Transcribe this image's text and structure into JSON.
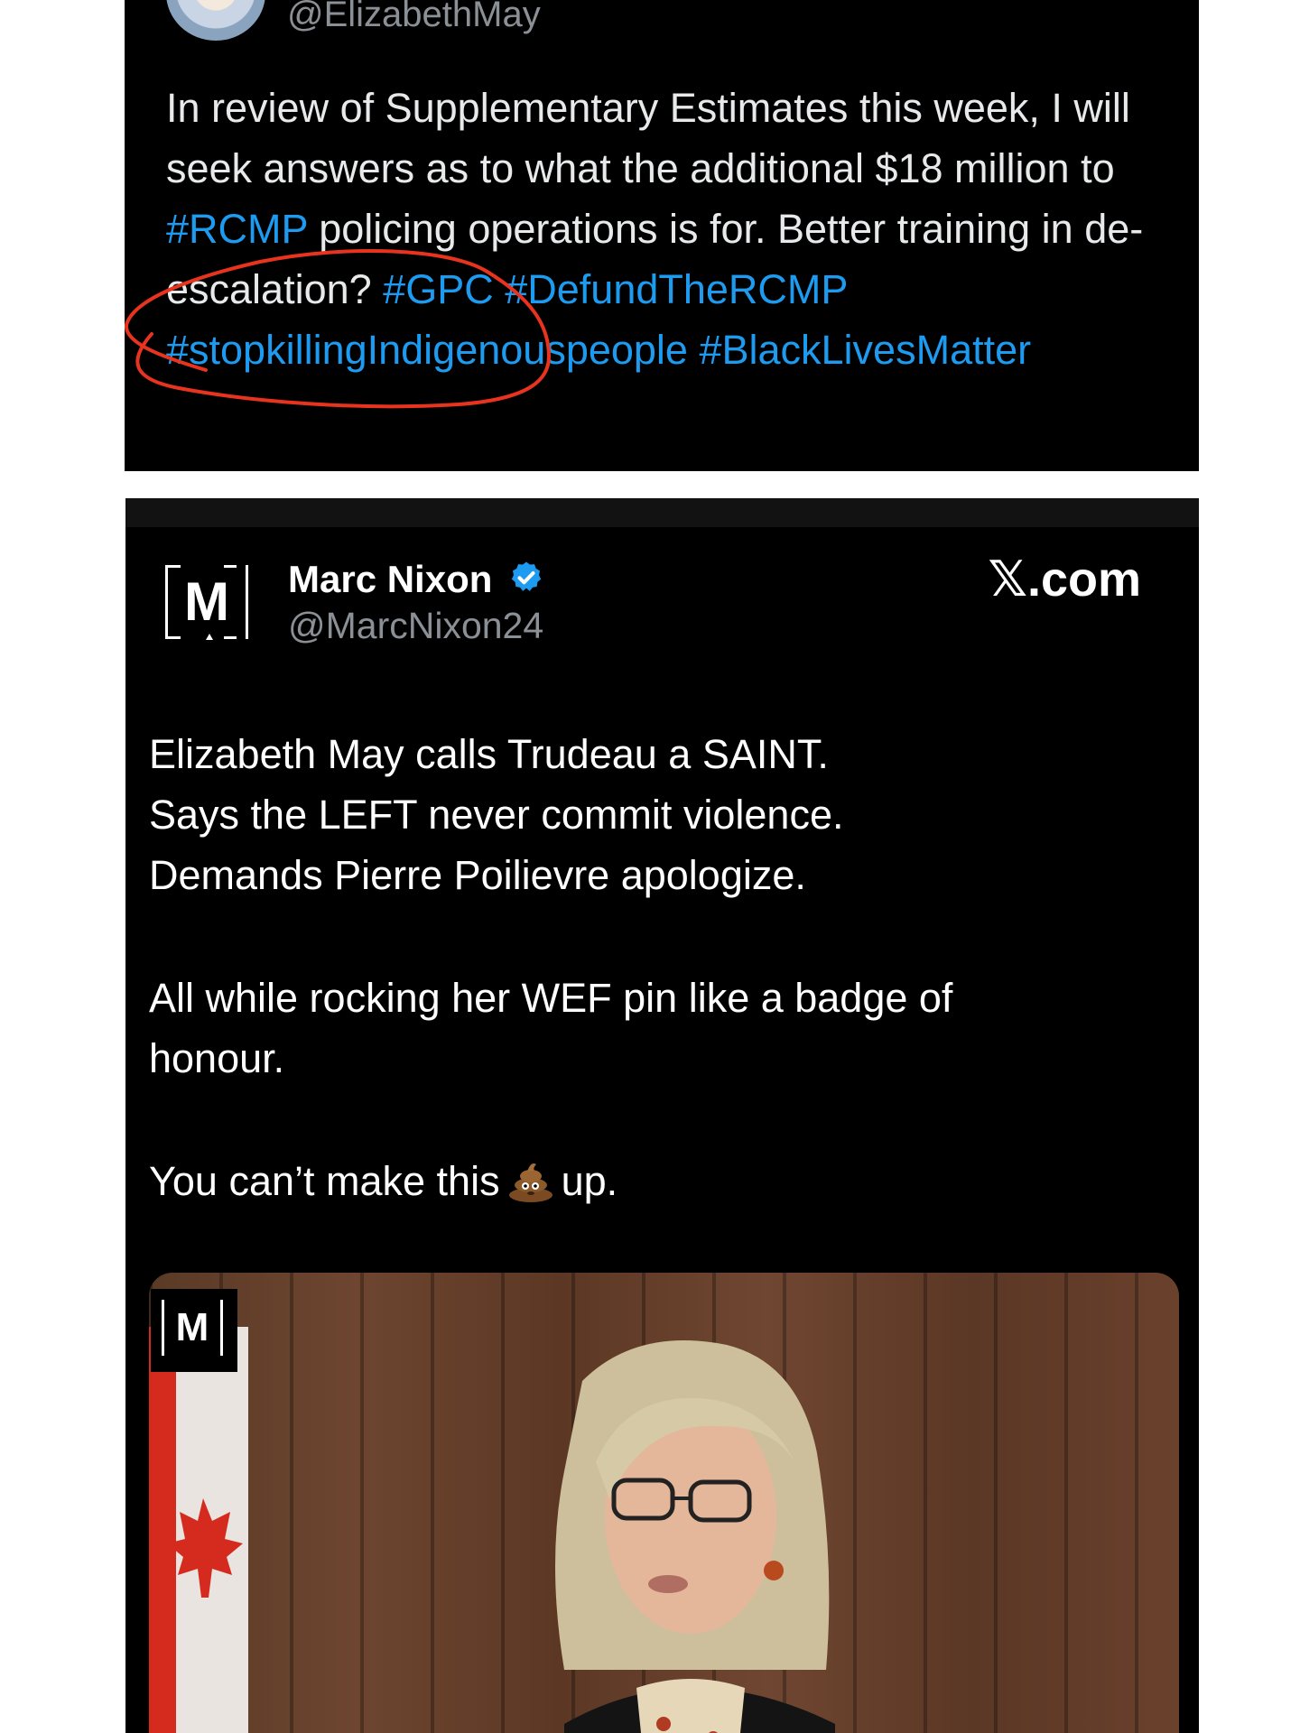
{
  "quoted_tweet": {
    "handle": "@ElizabethMay",
    "text_1": "In review of Supplementary Estimates this week, I will seek answers as to what the additional $18 million to ",
    "tag_rcmp": "#RCMP",
    "text_2": " policing operations is for. Better training in de-escalation? ",
    "tag_gpc": "#GPC",
    "tag_defund": "#DefundTheRCMP",
    "tag_stopkilling": "#stopkillingIndigenouspeople",
    "tag_blm": "#BlackLivesMatter",
    "hashtag_color": "#1d9bf0"
  },
  "post": {
    "author_name": "Marc Nixon",
    "author_handle": "@MarcNixon24",
    "logo_letter": "M",
    "brand": "𝕏.com",
    "verified_color": "#1d9bf0",
    "line_1": "Elizabeth May calls Trudeau a SAINT.",
    "line_2": "Says the LEFT never commit violence.",
    "line_3": "Demands Pierre Poilievre apologize.",
    "line_4": "All while rocking her WEF pin like a badge of",
    "line_5": "honour.",
    "line_6a": "You can’t make this",
    "line_6b": "up.",
    "emoji": "pile-of-poo",
    "video_logo_letter": "M"
  },
  "colors": {
    "annotation_stroke": "#e8331f",
    "background": "#000000"
  }
}
